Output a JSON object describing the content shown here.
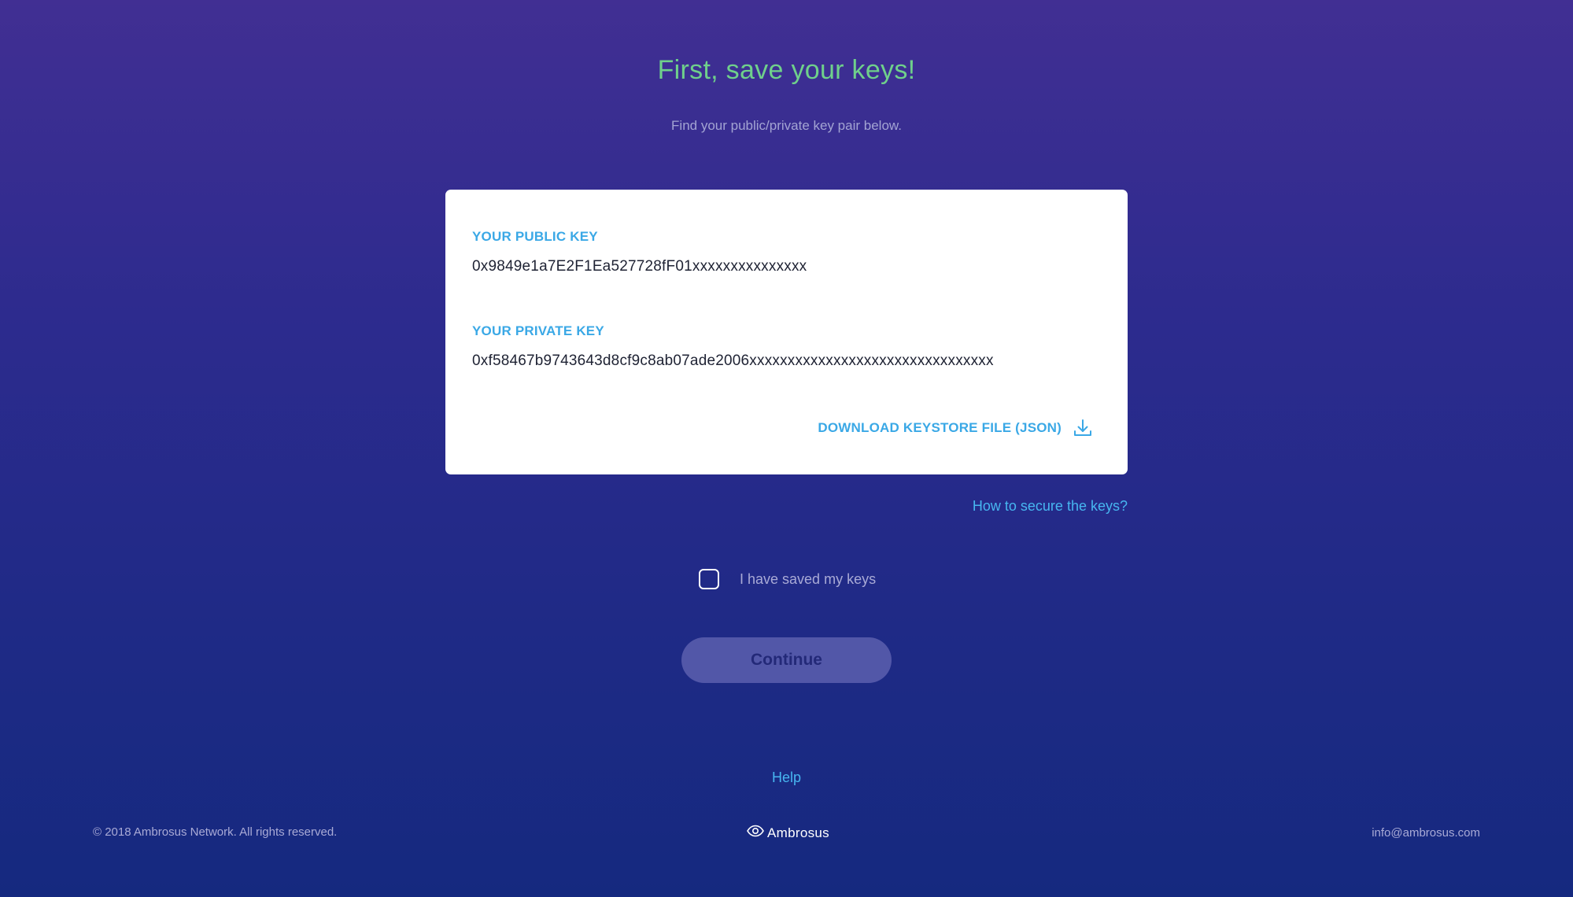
{
  "header": {
    "title": "First, save your keys!",
    "subtitle": "Find your public/private key pair below."
  },
  "keys": {
    "public_label": "YOUR PUBLIC KEY",
    "public_value": "0x9849e1a7E2F1Ea527728fF01xxxxxxxxxxxxxxx",
    "private_label": "YOUR PRIVATE KEY",
    "private_value": "0xf58467b9743643d8cf9c8ab07ade2006xxxxxxxxxxxxxxxxxxxxxxxxxxxxxxxx",
    "download_label": "DOWNLOAD KEYSTORE FILE (JSON)",
    "download_icon": "download-icon"
  },
  "secure_link": "How to secure the keys?",
  "confirm": {
    "label": "I have saved my keys",
    "checked": false
  },
  "continue_label": "Continue",
  "help_label": "Help",
  "footer": {
    "copyright": "© 2018 Ambrosus Network. All rights reserved.",
    "logo_text": "Ambrosus",
    "logo_icon": "eye-icon",
    "email": "info@ambrosus.com"
  },
  "colors": {
    "accent_green": "#6fd08b",
    "accent_blue": "#3aa8e6",
    "background_top": "#412f93",
    "background_bottom": "#15297f",
    "button_bg": "#5257a8"
  }
}
